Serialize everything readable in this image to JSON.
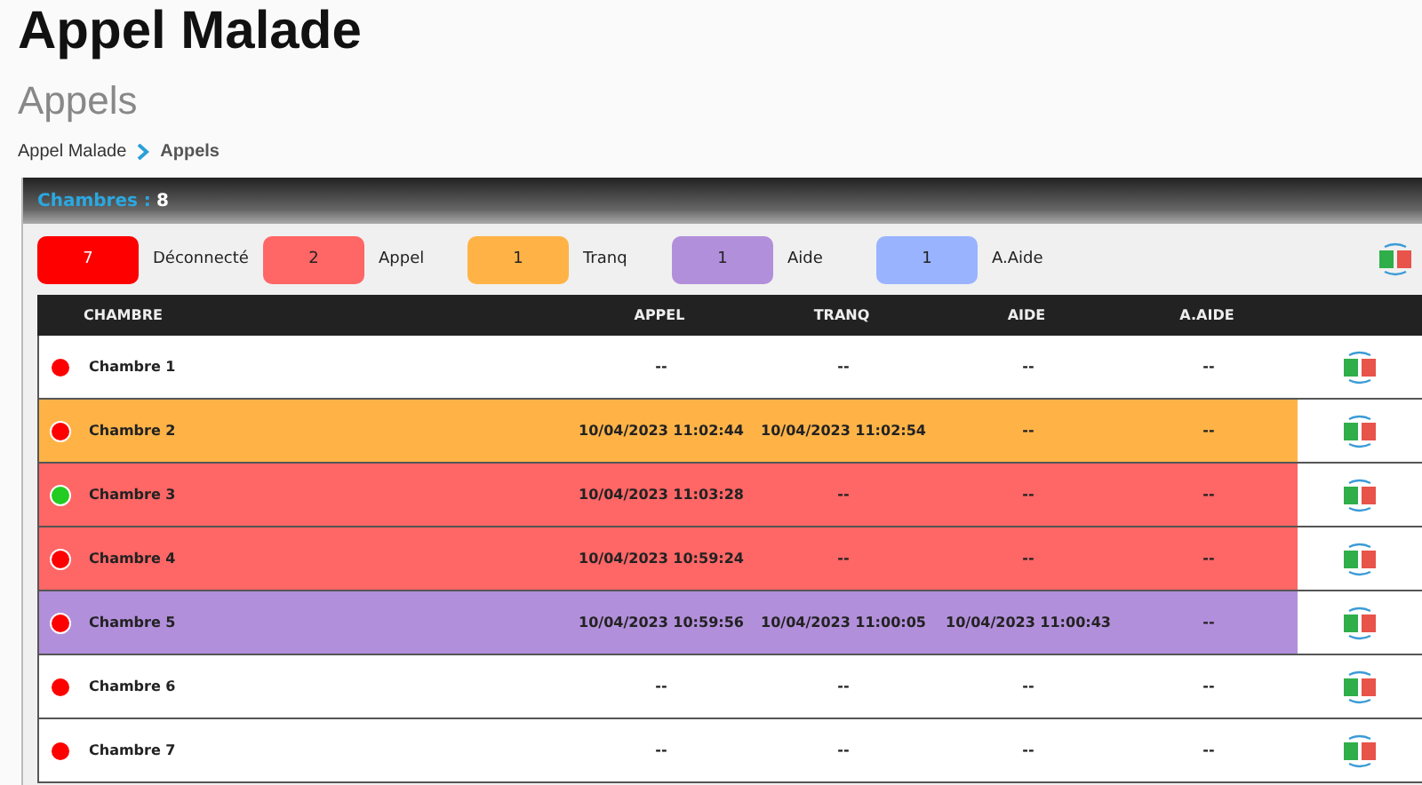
{
  "page": {
    "title": "Appel Malade",
    "subtitle": "Appels"
  },
  "breadcrumb": [
    {
      "label": "Appel Malade"
    },
    {
      "label": "Appels"
    }
  ],
  "panel": {
    "label": "Chambres :",
    "count": "8"
  },
  "legend": [
    {
      "count": "7",
      "label": "Déconnecté",
      "color": "#ff0000"
    },
    {
      "count": "2",
      "label": "Appel",
      "color": "#ff6666"
    },
    {
      "count": "1",
      "label": "Tranq",
      "color": "#ffb347"
    },
    {
      "count": "1",
      "label": "Aide",
      "color": "#b28fdb"
    },
    {
      "count": "1",
      "label": "A.Aide",
      "color": "#99b3ff"
    }
  ],
  "table": {
    "columns": [
      "CHAMBRE",
      "APPEL",
      "TRANQ",
      "AIDE",
      "A.AIDE"
    ],
    "rows": [
      {
        "kind": "none",
        "connected": false,
        "cells": [
          "Chambre 1",
          "--",
          "--",
          "--",
          "--"
        ]
      },
      {
        "kind": "tranq",
        "connected": false,
        "cells": [
          "Chambre 2",
          "10/04/2023 11:02:44",
          "10/04/2023 11:02:54",
          "--",
          "--"
        ]
      },
      {
        "kind": "appel",
        "connected": true,
        "cells": [
          "Chambre 3",
          "10/04/2023 11:03:28",
          "--",
          "--",
          "--"
        ]
      },
      {
        "kind": "appel",
        "connected": false,
        "cells": [
          "Chambre 4",
          "10/04/2023 10:59:24",
          "--",
          "--",
          "--"
        ]
      },
      {
        "kind": "aide",
        "connected": false,
        "cells": [
          "Chambre 5",
          "10/04/2023 10:59:56",
          "10/04/2023 11:00:05",
          "10/04/2023 11:00:43",
          "--"
        ]
      },
      {
        "kind": "none",
        "connected": false,
        "cells": [
          "Chambre 6",
          "--",
          "--",
          "--",
          "--"
        ]
      },
      {
        "kind": "none",
        "connected": false,
        "cells": [
          "Chambre 7",
          "--",
          "--",
          "--",
          "--"
        ]
      }
    ]
  }
}
